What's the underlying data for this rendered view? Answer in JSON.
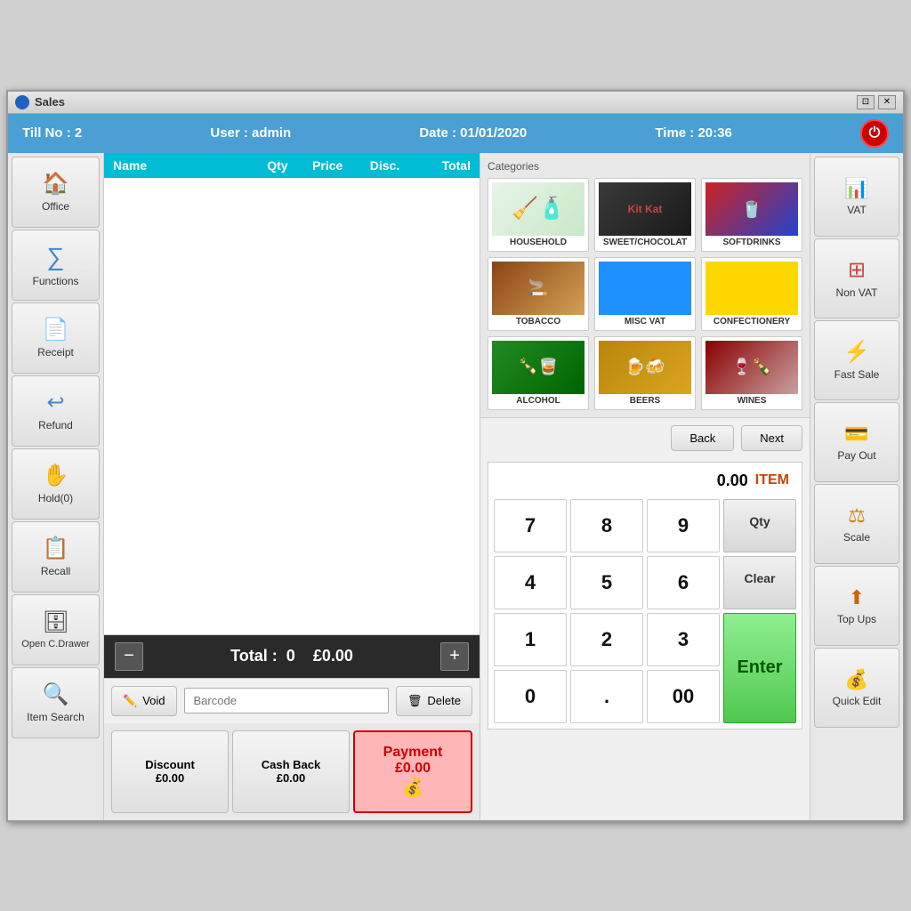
{
  "window": {
    "title": "Sales",
    "controls": [
      "restore",
      "close"
    ]
  },
  "header": {
    "till": "Till No : 2",
    "user": "User : admin",
    "date": "Date : 01/01/2020",
    "time": "Time : 20:36"
  },
  "sidebar": {
    "items": [
      {
        "id": "office",
        "label": "Office",
        "icon": "house"
      },
      {
        "id": "functions",
        "label": "Functions",
        "icon": "sigma"
      },
      {
        "id": "receipt",
        "label": "Receipt",
        "icon": "receipt"
      },
      {
        "id": "refund",
        "label": "Refund",
        "icon": "refund"
      },
      {
        "id": "hold",
        "label": "Hold(0)",
        "icon": "hold"
      },
      {
        "id": "recall",
        "label": "Recall",
        "icon": "recall"
      },
      {
        "id": "open-drawer",
        "label": "Open C.Drawer",
        "icon": "drawer"
      },
      {
        "id": "item-search",
        "label": "Item Search",
        "icon": "search"
      }
    ]
  },
  "table": {
    "headers": [
      "Name",
      "Qty",
      "Price",
      "Disc.",
      "Total"
    ],
    "rows": []
  },
  "total": {
    "label": "Total :",
    "count": "0",
    "amount": "£0.00"
  },
  "action_row": {
    "void_label": "Void",
    "barcode_placeholder": "Barcode",
    "delete_label": "Delete"
  },
  "bottom": {
    "discount_label": "Discount",
    "discount_amount": "£0.00",
    "cashback_label": "Cash Back",
    "cashback_amount": "£0.00",
    "payment_label": "Payment",
    "payment_amount": "£0.00"
  },
  "categories": {
    "label": "Categories",
    "items": [
      {
        "id": "household",
        "label": "HOUSEHOLD",
        "class": "cat-household",
        "icon": "🧹"
      },
      {
        "id": "sweet",
        "label": "SWEET/CHOCOLAT",
        "class": "cat-sweet",
        "icon": "🍫"
      },
      {
        "id": "softdrinks",
        "label": "SOFTDRINKS",
        "class": "cat-softdrinks",
        "icon": "🥤"
      },
      {
        "id": "tobacco",
        "label": "TOBACCO",
        "class": "cat-tobacco",
        "icon": "🚬"
      },
      {
        "id": "miscvat",
        "label": "MISC VAT",
        "class": "cat-miscvat",
        "icon": ""
      },
      {
        "id": "confectionery",
        "label": "CONFECTIONERY",
        "class": "cat-confectionery",
        "icon": ""
      },
      {
        "id": "alcohol",
        "label": "ALCOHOL",
        "class": "cat-alcohol",
        "icon": "🍾"
      },
      {
        "id": "beers",
        "label": "BEERS",
        "class": "cat-beers",
        "icon": "🍺"
      },
      {
        "id": "wines",
        "label": "WINES",
        "class": "cat-wines",
        "icon": "🍷"
      }
    ]
  },
  "nav": {
    "back_label": "Back",
    "next_label": "Next"
  },
  "numpad": {
    "display_value": "0.00",
    "item_label": "ITEM",
    "buttons": [
      "7",
      "8",
      "9",
      "4",
      "5",
      "6",
      "1",
      "2",
      "3",
      "0",
      ".",
      "00"
    ],
    "qty_label": "Qty",
    "clear_label": "Clear",
    "enter_label": "Enter"
  },
  "right_sidebar": {
    "items": [
      {
        "id": "vat",
        "label": "VAT",
        "icon": "vat"
      },
      {
        "id": "nonvat",
        "label": "Non VAT",
        "icon": "nonvat"
      },
      {
        "id": "fastsale",
        "label": "Fast Sale",
        "icon": "fastsale"
      },
      {
        "id": "payout",
        "label": "Pay Out",
        "icon": "payout"
      },
      {
        "id": "scale",
        "label": "Scale",
        "icon": "scale"
      },
      {
        "id": "topups",
        "label": "Top Ups",
        "icon": "topups"
      },
      {
        "id": "quickedit",
        "label": "Quick Edit",
        "icon": "quickedit"
      }
    ]
  }
}
